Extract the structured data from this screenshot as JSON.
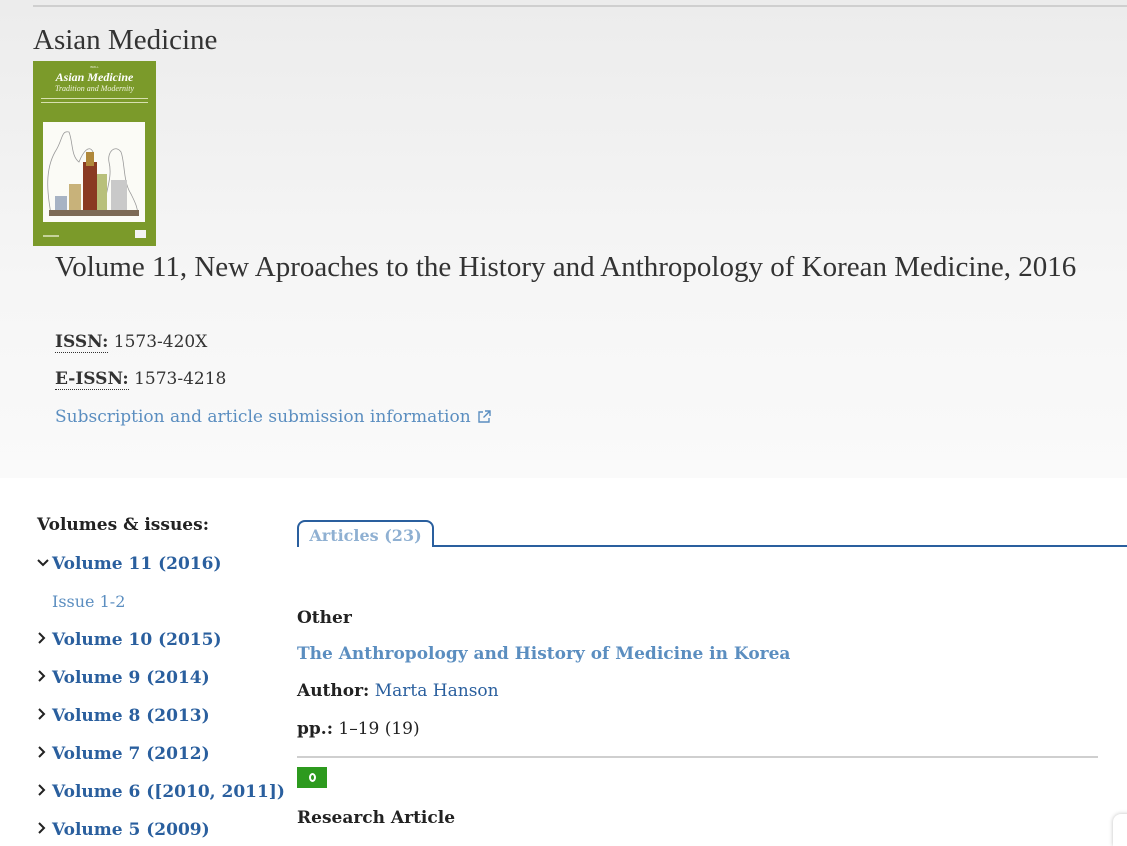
{
  "journal": {
    "title": "Asian Medicine",
    "cover": {
      "small_text": "BRILL",
      "title": "Asian Medicine",
      "subtitle": "Tradition and Modernity"
    }
  },
  "volume": {
    "title": "Volume 11, New Aproaches to the History and Anthropology of Korean Medicine, 2016",
    "issn_label": "ISSN:",
    "issn_value": " 1573-420X",
    "eissn_label": "E-ISSN:",
    "eissn_value": " 1573-4218",
    "subscription_link": "Subscription and article submission information"
  },
  "sidebar": {
    "heading": "Volumes & issues:",
    "volumes": [
      {
        "label": "Volume 11 (2016)",
        "expanded": true
      },
      {
        "label": "Volume 10 (2015)",
        "expanded": false
      },
      {
        "label": "Volume 9 (2014)",
        "expanded": false
      },
      {
        "label": "Volume 8 (2013)",
        "expanded": false
      },
      {
        "label": "Volume 7 (2012)",
        "expanded": false
      },
      {
        "label": "Volume 6 ([2010, 2011])",
        "expanded": false
      },
      {
        "label": "Volume 5 (2009)",
        "expanded": false
      }
    ],
    "issue": "Issue 1-2",
    "chevron_expanded": "⌄",
    "chevron_collapsed": "›"
  },
  "tabs": [
    {
      "label": "Articles (23)"
    }
  ],
  "articles": [
    {
      "type": "Other",
      "title": "The Anthropology and History of Medicine in Korea",
      "author_label": "Author:",
      "author": " Marta Hanson",
      "pages_label": "pp.:",
      "pages": " 1–19 (19)"
    }
  ],
  "next_section_type": "Research Article",
  "colors": {
    "link": "#5b8ec0",
    "volume_link": "#2a5f9e",
    "open_access": "#2d9a1e",
    "cover": "#7b9a2a"
  }
}
